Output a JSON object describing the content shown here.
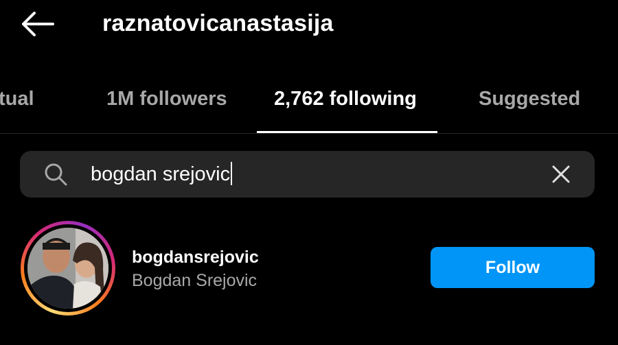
{
  "header": {
    "back_icon": "arrow-left-icon",
    "title": "raznatovicanastasija"
  },
  "tabs": [
    {
      "label": "tual",
      "active": false
    },
    {
      "label": "1M followers",
      "active": false
    },
    {
      "label": "2,762 following",
      "active": true
    },
    {
      "label": "Suggested",
      "active": false
    }
  ],
  "search": {
    "icon": "search-icon",
    "value": "bogdan srejovic",
    "clear_icon": "close-icon"
  },
  "results": [
    {
      "username": "bogdansrejovic",
      "full_name": "Bogdan Srejovic",
      "has_story": true,
      "follow_label": "Follow"
    }
  ],
  "colors": {
    "background": "#000000",
    "search_bg": "#262626",
    "secondary_text": "#a8a8a8",
    "follow_button": "#0095f6"
  }
}
